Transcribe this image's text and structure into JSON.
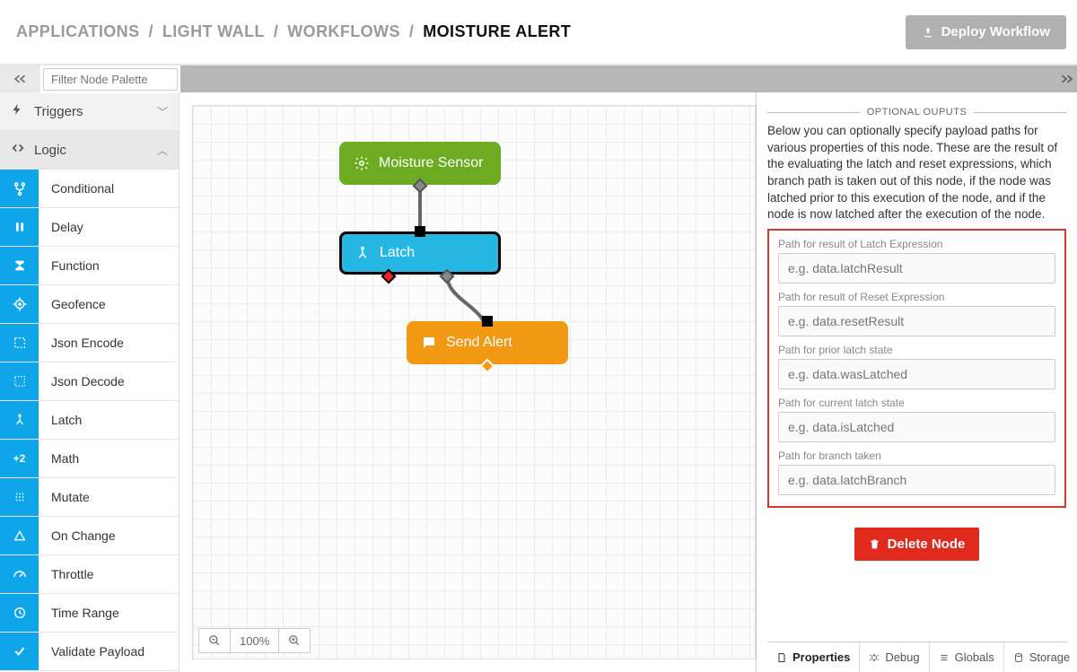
{
  "breadcrumb": {
    "applications": "APPLICATIONS",
    "project": "LIGHT WALL",
    "section": "WORKFLOWS",
    "page": "MOISTURE ALERT"
  },
  "deploy_button": "Deploy Workflow",
  "toolbar": {
    "filter_placeholder": "Filter Node Palette"
  },
  "palette": {
    "triggers_label": "Triggers",
    "logic_label": "Logic",
    "nodes": [
      {
        "key": "conditional",
        "label": "Conditional"
      },
      {
        "key": "delay",
        "label": "Delay"
      },
      {
        "key": "function",
        "label": "Function"
      },
      {
        "key": "geofence",
        "label": "Geofence"
      },
      {
        "key": "json-encode",
        "label": "Json Encode"
      },
      {
        "key": "json-decode",
        "label": "Json Decode"
      },
      {
        "key": "latch",
        "label": "Latch"
      },
      {
        "key": "math",
        "label": "Math"
      },
      {
        "key": "mutate",
        "label": "Mutate"
      },
      {
        "key": "on-change",
        "label": "On Change"
      },
      {
        "key": "throttle",
        "label": "Throttle"
      },
      {
        "key": "time-range",
        "label": "Time Range"
      },
      {
        "key": "validate-payload",
        "label": "Validate Payload"
      }
    ]
  },
  "canvas": {
    "zoom_level": "100%",
    "nodes": {
      "sensor": "Moisture Sensor",
      "latch": "Latch",
      "alert": "Send Alert"
    }
  },
  "inspector": {
    "section_title": "OPTIONAL OUPUTS",
    "description": "Below you can optionally specify payload paths for various properties of this node. These are the result of the evaluating the latch and reset expressions, which branch path is taken out of this node, if the node was latched prior to this execution of the node, and if the node is now latched after the execution of the node.",
    "fields": [
      {
        "label": "Path for result of Latch Expression",
        "placeholder": "e.g. data.latchResult"
      },
      {
        "label": "Path for result of Reset Expression",
        "placeholder": "e.g. data.resetResult"
      },
      {
        "label": "Path for prior latch state",
        "placeholder": "e.g. data.wasLatched"
      },
      {
        "label": "Path for current latch state",
        "placeholder": "e.g. data.isLatched"
      },
      {
        "label": "Path for branch taken",
        "placeholder": "e.g. data.latchBranch"
      }
    ],
    "delete_label": "Delete Node",
    "tabs": {
      "properties": "Properties",
      "debug": "Debug",
      "globals": "Globals",
      "storage": "Storage"
    }
  }
}
